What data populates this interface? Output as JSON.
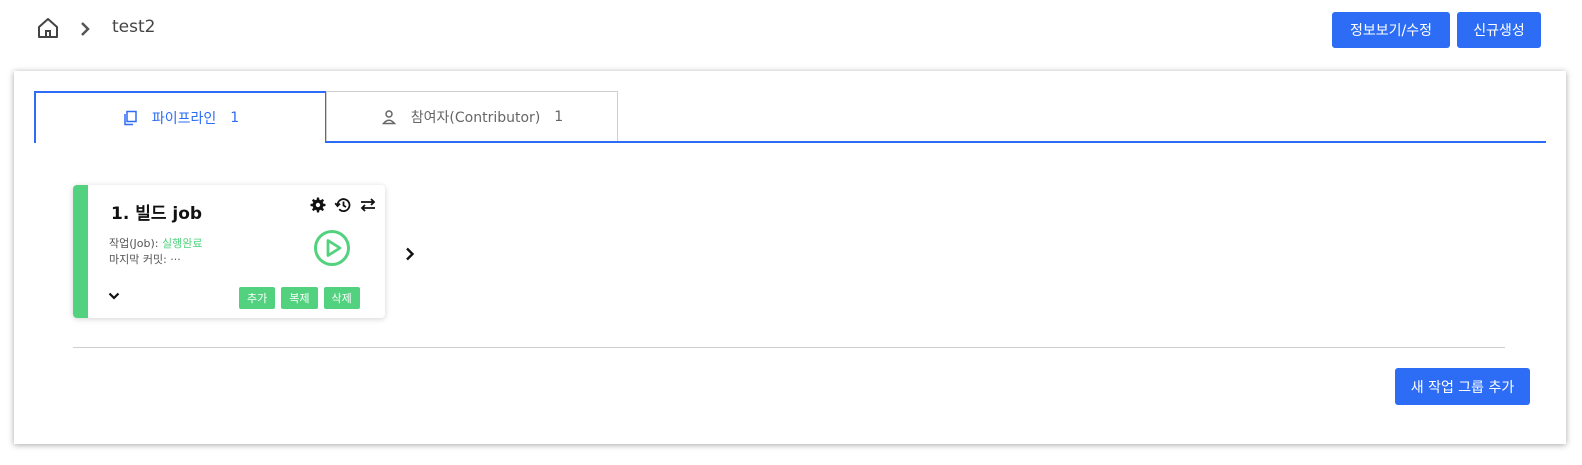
{
  "breadcrumb": {
    "current": "test2"
  },
  "header": {
    "edit_label": "정보보기/수정",
    "new_label": "신규생성"
  },
  "tabs": [
    {
      "label": "파이프라인",
      "count": "1"
    },
    {
      "label": "참여자(Contributor)",
      "count": "1"
    }
  ],
  "job_card": {
    "title": "1. 빌드 job",
    "job_label": "작업(Job): ",
    "job_status": "실행완료",
    "last_commit": "마지막 커밋: ···",
    "buttons": {
      "add": "추가",
      "duplicate": "복제",
      "delete": "삭제"
    }
  },
  "footer": {
    "add_group_label": "새 작업 그룹 추가"
  },
  "colors": {
    "primary": "#2d6df6",
    "success": "#52d27f"
  }
}
